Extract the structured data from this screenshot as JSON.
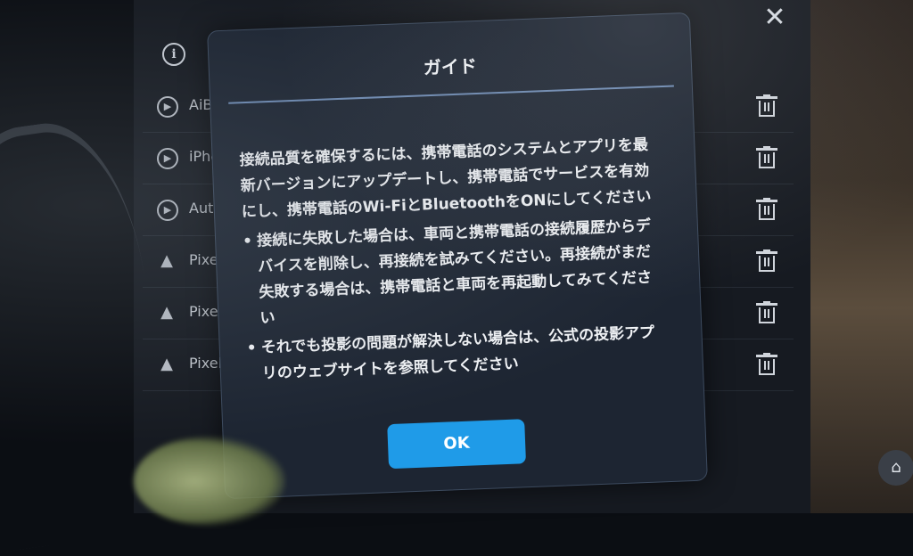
{
  "background": {
    "close_symbol": "✕",
    "info_symbol": "i",
    "devices": [
      {
        "name": "AiBox-",
        "icon": "play-icon"
      },
      {
        "name": "iPhone",
        "icon": "play-icon"
      },
      {
        "name": "AutoKi",
        "icon": "play-icon"
      },
      {
        "name": "Pixel 1",
        "icon": "android-auto-icon"
      },
      {
        "name": "Pixel",
        "icon": "android-auto-icon"
      },
      {
        "name": "Pixel",
        "icon": "android-auto-icon"
      }
    ]
  },
  "dialog": {
    "title": "ガイド",
    "intro": "接続品質を確保するには、携帯電話のシステムとアプリを最新バージョンにアップデートし、携帯電話でサービスを有効にし、携帯電話のWi-FiとBluetoothをONにしてください",
    "bullets": [
      "接続に失敗した場合は、車両と携帯電話の接続履歴からデバイスを削除し、再接続を試みてください。再接続がまだ失敗する場合は、携帯電話と車両を再起動してみてください",
      "それでも投影の問題が解決しない場合は、公式の投影アプリのウェブサイトを参照してください"
    ],
    "ok_label": "OK"
  },
  "colors": {
    "accent": "#1f9be8",
    "dialog_bg": "#1d2532",
    "divider": "#6e8bb4"
  }
}
